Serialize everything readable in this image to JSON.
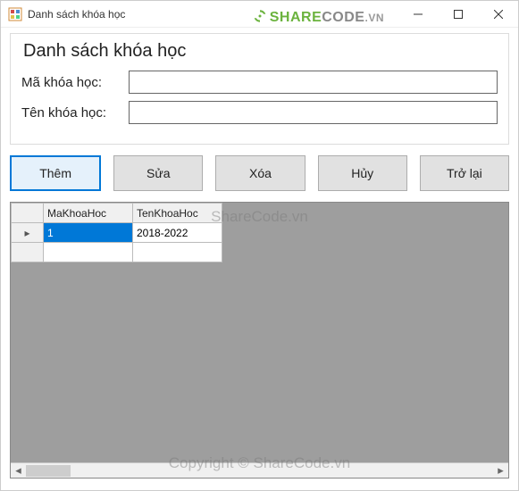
{
  "titlebar": {
    "title": "Danh sách khóa học"
  },
  "watermark_logo": {
    "green": "SHARE",
    "gray": "CODE",
    "suffix": ".VN"
  },
  "watermark_center": "ShareCode.vn",
  "watermark_bottom": "Copyright © ShareCode.vn",
  "form": {
    "heading": "Danh sách khóa học",
    "ma_label": "Mã khóa học:",
    "ten_label": "Tên khóa học:",
    "ma_value": "",
    "ten_value": ""
  },
  "buttons": {
    "them": "Thêm",
    "sua": "Sửa",
    "xoa": "Xóa",
    "huy": "Hủy",
    "trolai": "Trở lại"
  },
  "grid": {
    "columns": {
      "ma": "MaKhoaHoc",
      "ten": "TenKhoaHoc"
    },
    "rows": [
      {
        "ma": "1",
        "ten": "2018-2022"
      }
    ],
    "row_indicator": "▸"
  }
}
